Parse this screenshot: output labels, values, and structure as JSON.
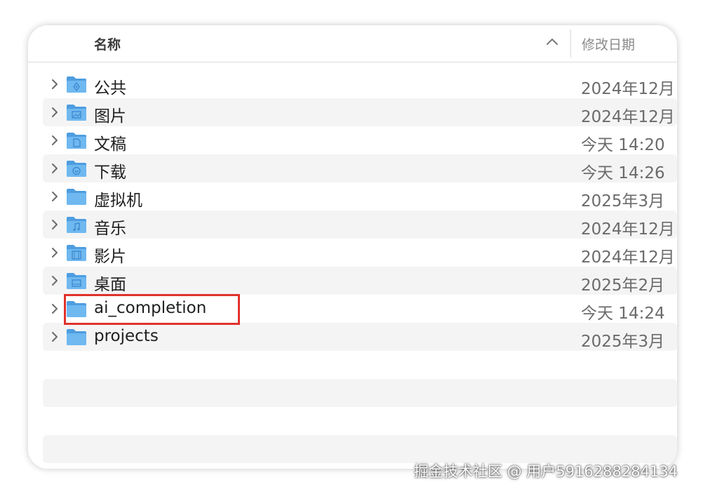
{
  "header": {
    "name_label": "名称",
    "date_label": "修改日期",
    "sort_icon": "chevron-up-icon"
  },
  "folders": [
    {
      "name": "公共",
      "date": "2024年12月",
      "icon": "public-folder-icon"
    },
    {
      "name": "图片",
      "date": "2024年12月",
      "icon": "pictures-folder-icon"
    },
    {
      "name": "文稿",
      "date": "今天 14:20",
      "icon": "documents-folder-icon"
    },
    {
      "name": "下载",
      "date": "今天 14:26",
      "icon": "downloads-folder-icon"
    },
    {
      "name": "虚拟机",
      "date": "2025年3月",
      "icon": "folder-icon"
    },
    {
      "name": "音乐",
      "date": "2024年12月",
      "icon": "music-folder-icon"
    },
    {
      "name": "影片",
      "date": "2024年12月",
      "icon": "movies-folder-icon"
    },
    {
      "name": "桌面",
      "date": "2025年2月",
      "icon": "desktop-folder-icon"
    },
    {
      "name": "ai_completion",
      "date": "今天 14:24",
      "icon": "folder-icon"
    },
    {
      "name": "projects",
      "date": "2025年3月",
      "icon": "folder-icon"
    }
  ],
  "colors": {
    "folder": "#6fb8f0",
    "folder_dark": "#4d9de0",
    "highlight": "#e0322b",
    "alt_row": "#f4f4f4"
  },
  "watermark": "掘金技术社区 @ 用户5916288284134"
}
